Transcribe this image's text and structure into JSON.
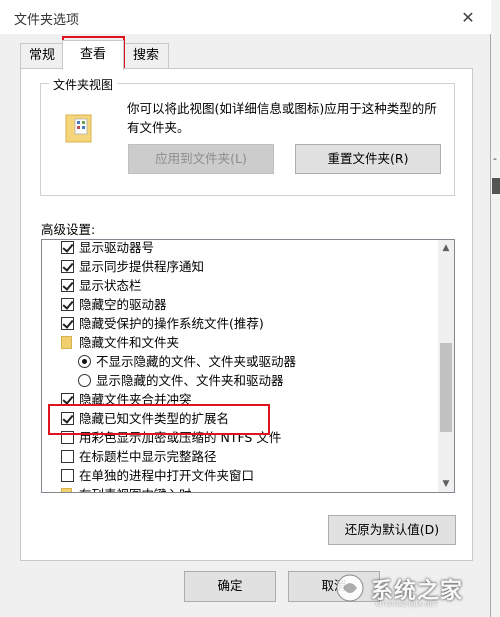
{
  "window": {
    "title": "文件夹选项",
    "close_symbol": "✕"
  },
  "tabs": [
    {
      "label": "常规"
    },
    {
      "label": "查看"
    },
    {
      "label": "搜索"
    }
  ],
  "folder_views": {
    "legend": "文件夹视图",
    "description": "你可以将此视图(如详细信息或图标)应用于这种类型的所有文件夹。",
    "apply_button": "应用到文件夹(L)",
    "reset_button": "重置文件夹(R)"
  },
  "advanced": {
    "label": "高级设置:",
    "items": [
      {
        "type": "checkbox",
        "checked": true,
        "indent": 0,
        "label": "显示驱动器号"
      },
      {
        "type": "checkbox",
        "checked": true,
        "indent": 0,
        "label": "显示同步提供程序通知"
      },
      {
        "type": "checkbox",
        "checked": true,
        "indent": 0,
        "label": "显示状态栏"
      },
      {
        "type": "checkbox",
        "checked": true,
        "indent": 0,
        "label": "隐藏空的驱动器"
      },
      {
        "type": "checkbox",
        "checked": true,
        "indent": 0,
        "label": "隐藏受保护的操作系统文件(推荐)"
      },
      {
        "type": "folder",
        "indent": 0,
        "label": "隐藏文件和文件夹"
      },
      {
        "type": "radio",
        "checked": true,
        "indent": 1,
        "label": "不显示隐藏的文件、文件夹或驱动器"
      },
      {
        "type": "radio",
        "checked": false,
        "indent": 1,
        "label": "显示隐藏的文件、文件夹和驱动器"
      },
      {
        "type": "checkbox",
        "checked": true,
        "indent": 0,
        "label": "隐藏文件夹合并冲突"
      },
      {
        "type": "checkbox",
        "checked": true,
        "indent": 0,
        "label": "隐藏已知文件类型的扩展名"
      },
      {
        "type": "checkbox",
        "checked": false,
        "indent": 0,
        "label": "用彩色显示加密或压缩的 NTFS 文件"
      },
      {
        "type": "checkbox",
        "checked": false,
        "indent": 0,
        "label": "在标题栏中显示完整路径"
      },
      {
        "type": "checkbox",
        "checked": false,
        "indent": 0,
        "label": "在单独的进程中打开文件夹窗口"
      },
      {
        "type": "folder",
        "indent": 0,
        "label": "在列表视图中键入时"
      }
    ],
    "restore_button": "还原为默认值(D)"
  },
  "footer": {
    "ok_button": "确定",
    "cancel_button": "取消"
  },
  "watermark": {
    "text": "系统之家",
    "sub": "XITONGZHIJIA.NET"
  },
  "colors": {
    "highlight": "#e0141e",
    "folder": "#f0cf70"
  }
}
